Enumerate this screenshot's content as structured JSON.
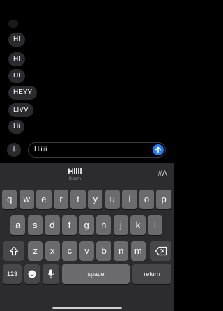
{
  "chat": {
    "messages": [
      "HI",
      "HI",
      "HI",
      "HEYY",
      "LIVV",
      "Hi"
    ]
  },
  "composer": {
    "message_text": "Hiiiii",
    "plus_label": "+"
  },
  "suggestion": {
    "word": "Hiiii",
    "subtitle": "Bloom",
    "right_label": "#A"
  },
  "keyboard": {
    "row1": [
      "q",
      "w",
      "e",
      "r",
      "t",
      "y",
      "u",
      "i",
      "o",
      "p"
    ],
    "row2": [
      "a",
      "s",
      "d",
      "f",
      "g",
      "h",
      "j",
      "k",
      "l"
    ],
    "row3": [
      "z",
      "x",
      "c",
      "v",
      "b",
      "n",
      "m"
    ],
    "numbers_label": "123",
    "space_label": "space",
    "return_label": "return"
  },
  "colors": {
    "send": "#1f7cf2",
    "key": "#6b6b6e",
    "key_dark": "#47474a",
    "keyboard_bg": "#2c2c2e"
  }
}
